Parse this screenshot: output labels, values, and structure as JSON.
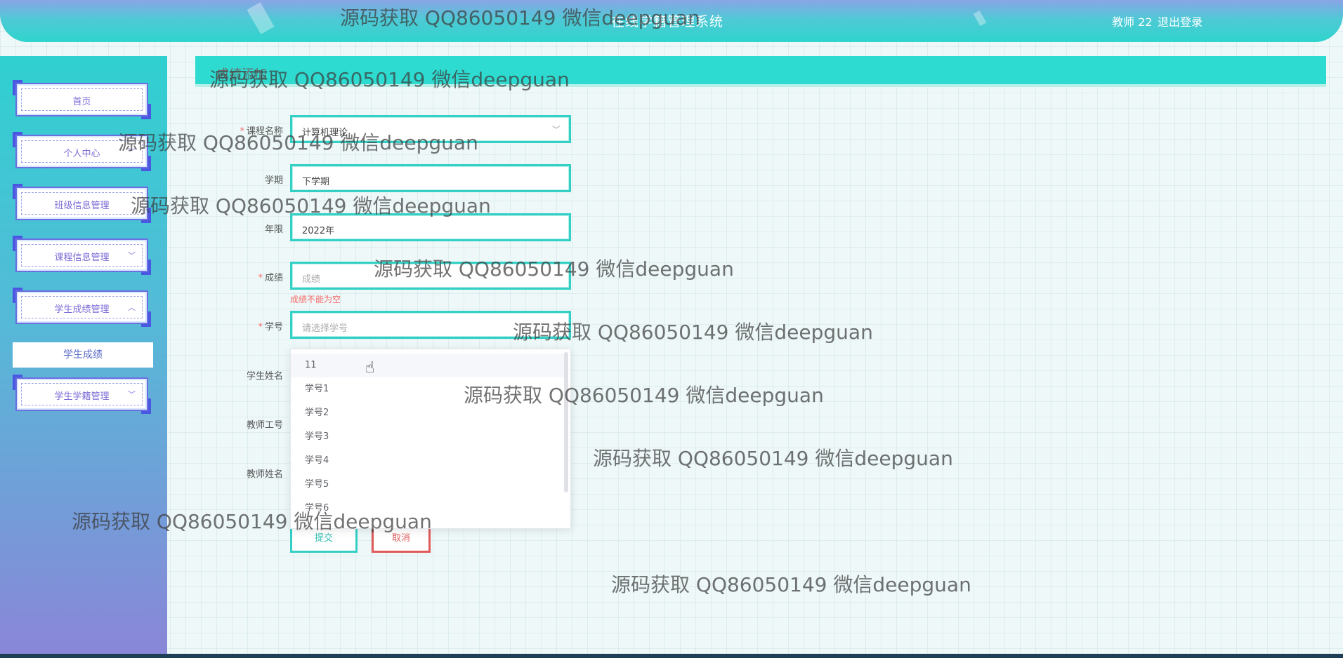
{
  "header": {
    "title": "在线学籍管理系统",
    "user": "教师 22",
    "logout": "退出登录"
  },
  "sidebar": {
    "items": [
      {
        "label": "首页",
        "chevron": ""
      },
      {
        "label": "个人中心",
        "chevron": "﹀"
      },
      {
        "label": "班级信息管理",
        "chevron": ""
      },
      {
        "label": "课程信息管理",
        "chevron": "﹀"
      },
      {
        "label": "学生成绩管理",
        "chevron": "︿"
      },
      {
        "label": "学生学籍管理",
        "chevron": "﹀"
      }
    ],
    "submenu": "学生成绩"
  },
  "page": {
    "title": "成绩添加"
  },
  "form": {
    "course": {
      "label": "课程名称",
      "value": "计算机理论"
    },
    "term": {
      "label": "学期",
      "value": "下学期"
    },
    "year": {
      "label": "年限",
      "value": "2022年"
    },
    "score": {
      "label": "成绩",
      "placeholder": "成绩",
      "error": "成绩不能为空"
    },
    "student_id": {
      "label": "学号",
      "placeholder": "请选择学号"
    },
    "student_name": {
      "label": "学生姓名"
    },
    "teacher_id": {
      "label": "教师工号"
    },
    "teacher_name": {
      "label": "教师姓名"
    },
    "submit": "提交",
    "cancel": "取消"
  },
  "dropdown": {
    "options": [
      "11",
      "学号1",
      "学号2",
      "学号3",
      "学号4",
      "学号5",
      "学号6"
    ]
  },
  "watermark": "源码获取 QQ86050149 微信deepguan",
  "colors": {
    "accent": "#2edbd0",
    "sidebar_top": "#2fd0d0",
    "sidebar_bottom": "#8a86d8",
    "error": "#f56c6c"
  }
}
